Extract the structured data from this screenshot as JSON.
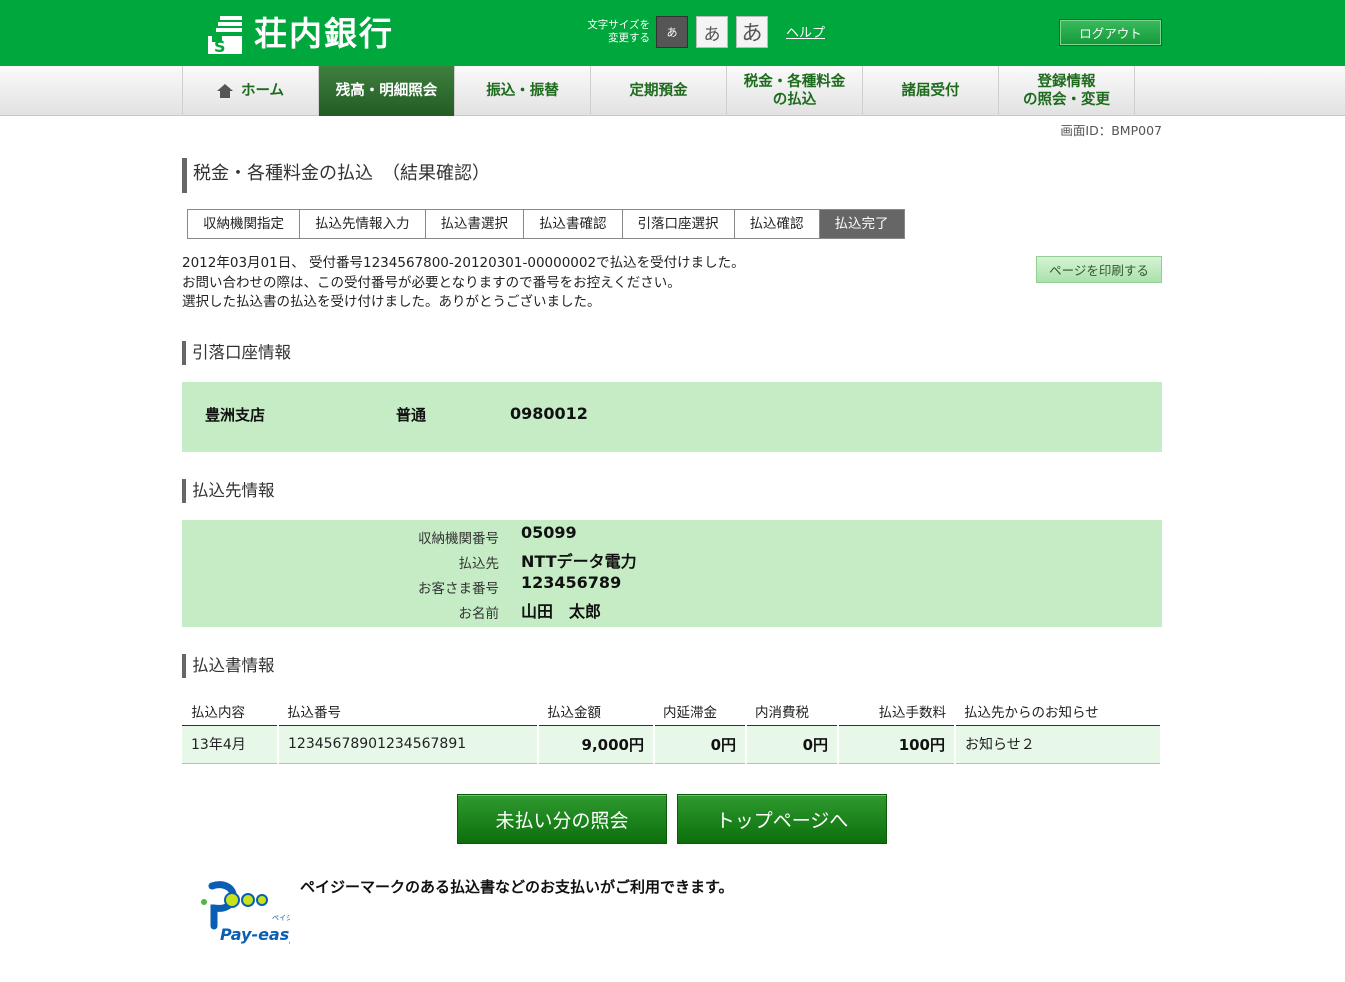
{
  "header": {
    "bank_name": "荘内銀行",
    "font_size_label": "文字サイズを\n変更する",
    "font_small": "あ",
    "font_mid": "あ",
    "font_large": "あ",
    "help": "ヘルプ",
    "logout": "ログアウト"
  },
  "nav": {
    "items": [
      {
        "label": "ホーム"
      },
      {
        "label": "残高・明細照会"
      },
      {
        "label": "振込・振替"
      },
      {
        "label": "定期預金"
      },
      {
        "label": "税金・各種料金\nの払込"
      },
      {
        "label": "諸届受付"
      },
      {
        "label": "登録情報\nの照会・変更"
      }
    ]
  },
  "screen_id": "画面ID：BMP007",
  "page_title": "税金・各種料金の払込　（結果確認）",
  "steps": [
    "収納機関指定",
    "払込先情報入力",
    "払込書選択",
    "払込書確認",
    "引落口座選択",
    "払込確認",
    "払込完了"
  ],
  "message": {
    "line1": "2012年03月01日、 受付番号1234567800-20120301-00000002で払込を受付けました。",
    "line2": "お問い合わせの際は、この受付番号が必要となりますので番号をお控えください。",
    "line3": "選択した払込書の払込を受け付けました。ありがとうございました。"
  },
  "print_button": "ページを印刷する",
  "account_section": {
    "title": "引落口座情報",
    "branch": "豊洲支店",
    "type": "普通",
    "number": "0980012"
  },
  "payee_section": {
    "title": "払込先情報",
    "rows": [
      {
        "key": "収納機関番号",
        "value": "05099"
      },
      {
        "key": "払込先",
        "value": "NTTデータ電力"
      },
      {
        "key": "お客さま番号",
        "value": "123456789"
      },
      {
        "key": "お名前",
        "value": "山田　太郎"
      }
    ]
  },
  "bill_section": {
    "title": "払込書情報",
    "headers": [
      "払込内容",
      "払込番号",
      "払込金額",
      "内延滞金",
      "内消費税",
      "払込手数料",
      "払込先からのお知らせ"
    ],
    "rows": [
      [
        "13年4月",
        "12345678901234567891",
        "9,000円",
        "0円",
        "0円",
        "100円",
        "お知らせ２"
      ]
    ]
  },
  "buttons": {
    "unpaid": "未払い分の照会",
    "top": "トップページへ"
  },
  "payeasy": {
    "logo_text": "Pay-easy",
    "logo_kana": "ペイジー",
    "message": "ペイジーマークのある払込書などのお支払いがご利用できます。"
  },
  "colors": {
    "brand_green": "#00a73c",
    "panel_green": "#c5ecc5",
    "button_green": "#1a801a"
  }
}
